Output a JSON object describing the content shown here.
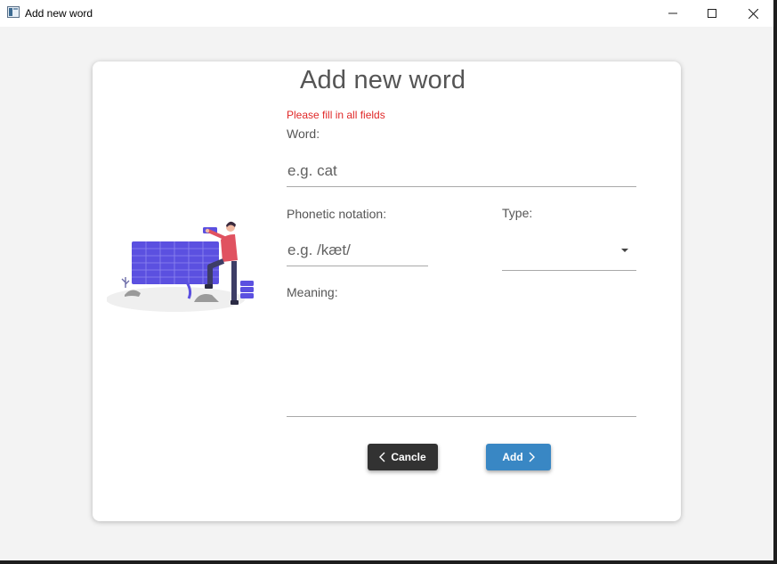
{
  "window": {
    "title": "Add new word",
    "controls": {
      "minimize": "minimize-icon",
      "maximize": "maximize-icon",
      "close": "close-icon"
    }
  },
  "dialog": {
    "title": "Add new word",
    "error": "Please fill in all fields",
    "word": {
      "label": "Word:",
      "placeholder": "e.g. cat",
      "value": ""
    },
    "phonetic": {
      "label": "Phonetic notation:",
      "placeholder": "e.g. /kæt/",
      "value": ""
    },
    "type": {
      "label": "Type:",
      "selected": ""
    },
    "meaning": {
      "label": "Meaning:",
      "value": ""
    },
    "buttons": {
      "cancel": "Cancle",
      "add": "Add"
    }
  },
  "colors": {
    "accent": "#3987c4",
    "cancel_button": "#323232",
    "error": "#e02828",
    "illustration_bricks": "#5b50e0",
    "illustration_shirt": "#e05260"
  }
}
